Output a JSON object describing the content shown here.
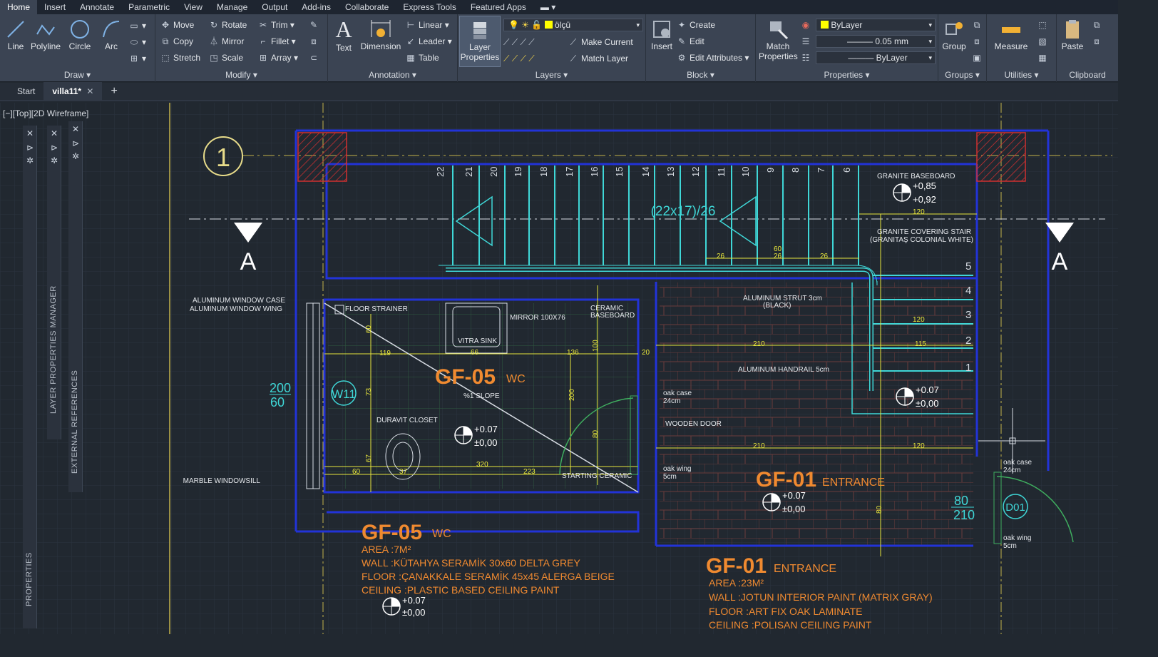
{
  "menu_tabs": [
    "Home",
    "Insert",
    "Annotate",
    "Parametric",
    "View",
    "Manage",
    "Output",
    "Add-ins",
    "Collaborate",
    "Express Tools",
    "Featured Apps"
  ],
  "ribbon": {
    "draw": {
      "title": "Draw",
      "line": "Line",
      "polyline": "Polyline",
      "circle": "Circle",
      "arc": "Arc"
    },
    "modify": {
      "title": "Modify",
      "move": "Move",
      "rotate": "Rotate",
      "trim": "Trim",
      "copy": "Copy",
      "mirror": "Mirror",
      "fillet": "Fillet",
      "stretch": "Stretch",
      "scale": "Scale",
      "array": "Array"
    },
    "annotation": {
      "title": "Annotation",
      "text": "Text",
      "dimension": "Dimension",
      "linear": "Linear",
      "leader": "Leader",
      "table": "Table"
    },
    "layers": {
      "title": "Layers",
      "layer_properties": "Layer Properties",
      "current_layer": "ölçü",
      "make_current": "Make Current",
      "match_layer": "Match Layer"
    },
    "block": {
      "title": "Block",
      "insert": "Insert",
      "create": "Create",
      "edit": "Edit",
      "edit_attributes": "Edit Attributes"
    },
    "properties": {
      "title": "Properties",
      "match_properties": "Match Properties",
      "color": "ByLayer",
      "lineweight": "0.05 mm",
      "linetype": "ByLayer"
    },
    "groups": {
      "title": "Groups",
      "group": "Group"
    },
    "utilities": {
      "title": "Utilities",
      "measure": "Measure"
    },
    "clipboard": {
      "title": "Clipboard",
      "paste": "Paste"
    }
  },
  "file_tabs": {
    "start": "Start",
    "active": "villa11*"
  },
  "viewport_label": "[−][Top][2D Wireframe]",
  "palettes": {
    "layer_manager": "LAYER PROPERTIES MANAGER",
    "external_refs": "EXTERNAL REFERENCES",
    "properties": "PROPERTIES"
  },
  "drawing": {
    "grid_bubble": "1",
    "section_mark": "A",
    "stair_numbers": [
      "22",
      "21",
      "20",
      "19",
      "18",
      "17",
      "16",
      "15",
      "14",
      "13",
      "12",
      "11",
      "10",
      "9",
      "8",
      "7",
      "6"
    ],
    "landing_numbers": [
      "5",
      "4",
      "3",
      "2",
      "1"
    ],
    "stair_formula": "(22x17)/26",
    "labels": {
      "granite_baseboard": "GRANITE BASEBOARD",
      "granite_covering": "GRANITE COVERING STAIR",
      "granite_covering2": "(GRANITAŞ COLONIAL WHITE)",
      "alu_window_case": "ALUMINUM WINDOW CASE",
      "alu_window_wing": "ALUMINUM WINDOW WING",
      "floor_strainer": "FLOOR STRAINER",
      "mirror": "MIRROR 100X76",
      "ceramic_baseboard": "CERAMIC",
      "ceramic_baseboard2": "BASEBOARD",
      "vitra_sink": "VITRA SINK",
      "slope": "%1 SLOPE",
      "duravit": "DURAVIT CLOSET",
      "marble_sill": "MARBLE WINDOWSILL",
      "starting_ceramic": "STARTING CERAMIC",
      "alu_strut": "ALUMINUM STRUT 3cm",
      "alu_strut2": "(BLACK)",
      "alu_handrail": "ALUMINUM HANDRAIL 5cm",
      "oak_case": "oak case",
      "oak_case_size": "24cm",
      "wooden_door": "WOODEN DOOR",
      "oak_wing": "oak wing",
      "oak_wing_size": "5cm",
      "window_tag": "W11",
      "window_w": "200",
      "window_h": "60",
      "door_tag": "D01",
      "door_w": "80",
      "door_h": "210"
    },
    "levels": {
      "l1a": "+0,85",
      "l1b": "+0,92",
      "l2a": "+0.07",
      "l2b": "±0,00"
    },
    "dims": {
      "d119": "119",
      "d66": "66",
      "d136": "136",
      "d20": "20",
      "d60": "60",
      "d37": "37",
      "d320": "320",
      "d223": "223",
      "d100": "100",
      "d200": "200",
      "d80": "80",
      "d210": "210",
      "d120": "120",
      "d115": "115",
      "d26": "26",
      "d73": "73",
      "d67": "67"
    },
    "rooms": {
      "wc": {
        "code": "GF-05",
        "name": "WC",
        "area": "AREA :7M²",
        "wall": "WALL :KÜTAHYA SERAMİK 30x60 DELTA GREY",
        "floor": "FLOOR :ÇANAKKALE SERAMİK 45x45 ALERGA BEIGE",
        "ceiling": "CEILING :PLASTIC BASED CEILING PAINT"
      },
      "entrance": {
        "code": "GF-01",
        "name": "ENTRANCE",
        "area": "AREA :23M²",
        "wall": "WALL :JOTUN INTERIOR PAINT (MATRIX GRAY)",
        "floor": "FLOOR :ART FIX OAK LAMINATE",
        "ceiling": "CEILING :POLISAN CEILING PAINT"
      }
    }
  }
}
